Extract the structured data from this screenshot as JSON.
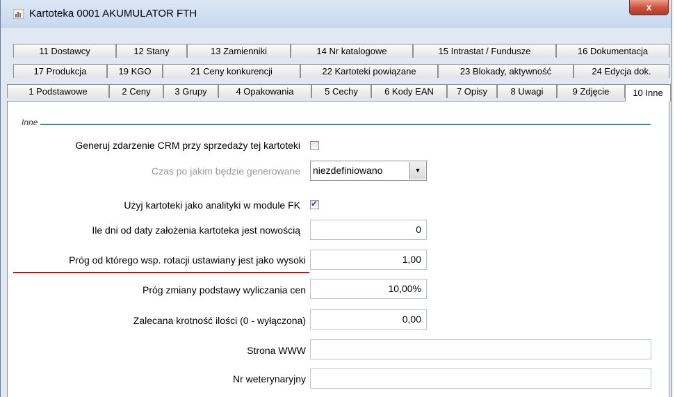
{
  "window": {
    "title": "Kartoteka  0001  AKUMULATOR FTH",
    "close_label": "x"
  },
  "tabs": {
    "row1": [
      "11 Dostawcy",
      "12 Stany",
      "13 Zamienniki",
      "14 Nr katalogowe",
      "15 Intrastat / Fundusze",
      "16 Dokumentacja"
    ],
    "row2": [
      "17 Produkcja",
      "19 KGO",
      "21 Ceny konkurencji",
      "22 Kartoteki powiązane",
      "23 Blokady, aktywność",
      "24 Edycja dok."
    ],
    "row3": [
      "1 Podstawowe",
      "2 Ceny",
      "3 Grupy",
      "4 Opakowania",
      "5 Cechy",
      "6 Kody EAN",
      "7 Opisy",
      "8 Uwagi",
      "9 Zdjęcie",
      "10 Inne"
    ],
    "active": "10 Inne"
  },
  "group": {
    "label": "Inne"
  },
  "fields": {
    "crm_label": "Generuj zdarzenie CRM przy sprzedaży tej  kartoteki",
    "crm_checked": false,
    "czas_label": "Czas po jakim będzie generowane",
    "czas_value": "niezdefiniowano",
    "fk_label": "Użyj kartoteki jako analityki w module FK",
    "fk_checked": true,
    "ile_dni_label": "Ile dni od daty założenia kartoteka jest nowością",
    "ile_dni_value": "0",
    "prog_rotacji_label": "Próg od którego wsp. rotacji ustawiany jest jako wysoki",
    "prog_rotacji_value": "1,00",
    "prog_zmiany_label": "Próg zmiany podstawy wyliczania cen",
    "prog_zmiany_value": "10,00%",
    "krotnosc_label": "Zalecana krotność ilości (0 - wyłączona)",
    "krotnosc_value": "0,00",
    "www_label": "Strona WWW",
    "www_value": "",
    "weterynaryjny_label": "Nr weterynaryjny",
    "weterynaryjny_value": ""
  },
  "colors": {
    "highlight_underline": "#e00000",
    "group_line": "#2f8f8b"
  }
}
